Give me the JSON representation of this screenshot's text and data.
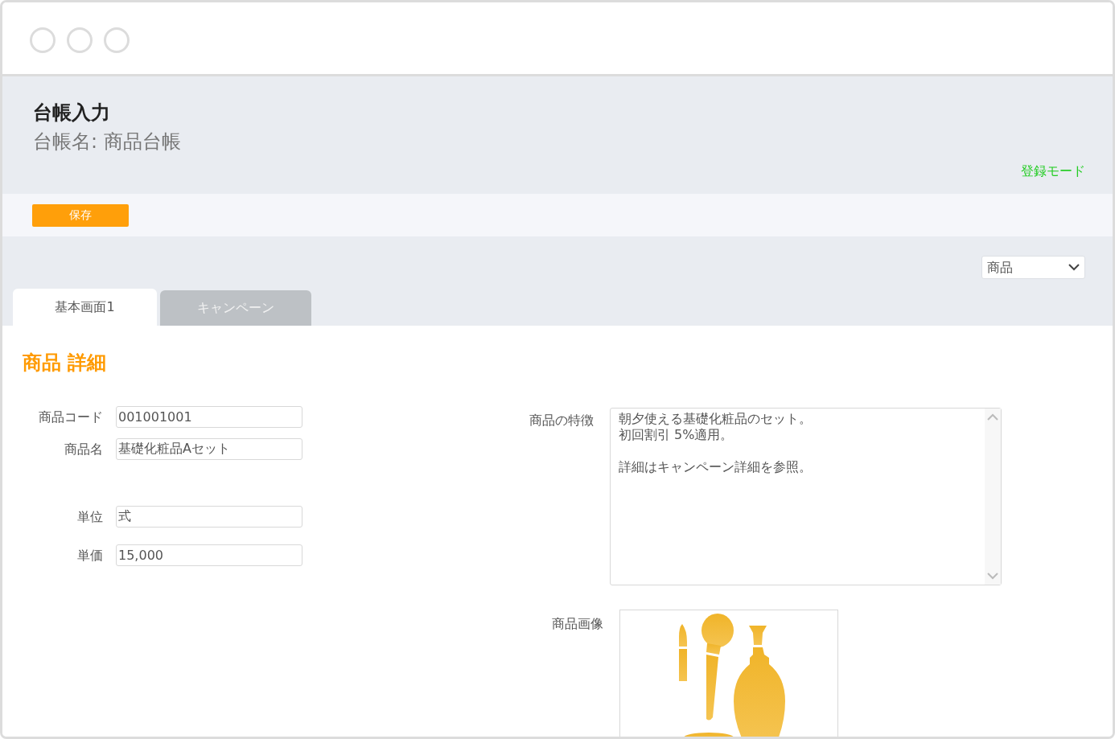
{
  "header": {
    "title": "台帳入力",
    "subtitle": "台帳名: 商品台帳",
    "mode": "登録モード"
  },
  "toolbar": {
    "save_button": "保存"
  },
  "view_select": {
    "value": "商品"
  },
  "tabs": [
    {
      "label": "基本画面1",
      "selected": true
    },
    {
      "label": "キャンペーン",
      "selected": false
    }
  ],
  "section": {
    "title": "商品 詳細"
  },
  "left_groups": [
    [
      {
        "label": "商品コード",
        "value": "001001001"
      },
      {
        "label": "商品名",
        "value": "基礎化粧品Aセット"
      }
    ],
    [
      {
        "label": "単位",
        "value": "式"
      },
      {
        "label": "単価",
        "value": "15,000"
      }
    ]
  ],
  "features": {
    "label": "商品の特徴",
    "paragraphs": [
      [
        "朝夕使える基礎化粧品のセット。",
        "初回割引 5%適用。"
      ],
      [
        "詳細はキャンペーン詳細を参照。"
      ]
    ]
  },
  "image": {
    "label": "商品画像"
  }
}
